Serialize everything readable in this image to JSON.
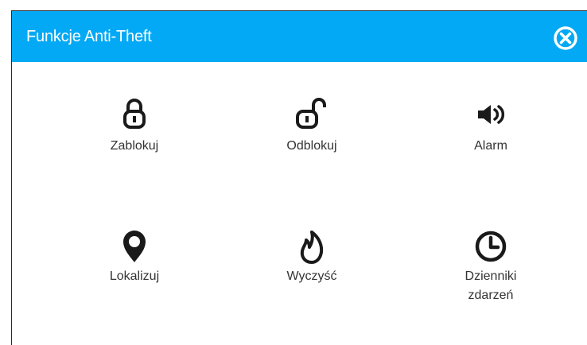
{
  "dialog": {
    "title": "Funkcje Anti-Theft",
    "close_icon": "close-circle-icon",
    "accent_color": "#03a9f4"
  },
  "actions": [
    {
      "label": "Zablokuj",
      "icon": "lock-icon"
    },
    {
      "label": "Odblokuj",
      "icon": "unlock-icon"
    },
    {
      "label": "Alarm",
      "icon": "speaker-icon"
    },
    {
      "label": "Lokalizuj",
      "icon": "location-pin-icon"
    },
    {
      "label": "Wyczyść",
      "icon": "fire-icon"
    },
    {
      "label": "Dzienniki zdarzeń",
      "icon": "clock-icon"
    }
  ]
}
